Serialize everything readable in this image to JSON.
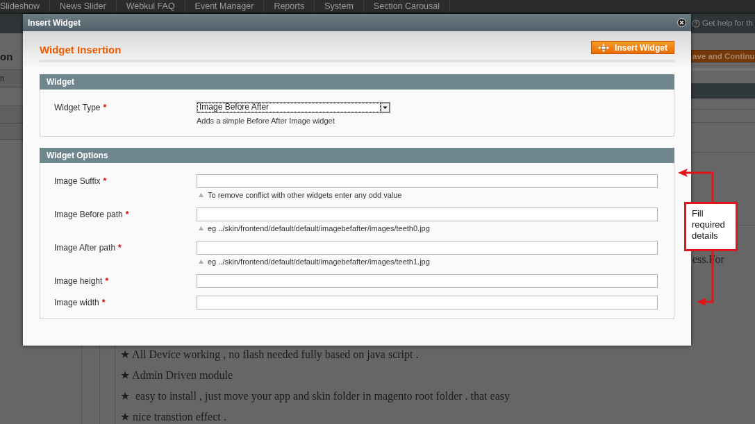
{
  "admin_nav": {
    "items": [
      "Slideshow",
      "News Slider",
      "Webkul FAQ",
      "Event Manager",
      "Reports",
      "System",
      "Section Carousal"
    ]
  },
  "header": {
    "help_text": "Get help for th"
  },
  "sidebar": {
    "heading": "on",
    "items": [
      "n"
    ]
  },
  "page": {
    "save_button": "ave and Continu",
    "paragraph_fragment": "ess.For",
    "features": [
      "★ All Device working , no flash needed fully based on java script .",
      "★ Admin Driven module",
      "★  easy to install , just move your app and skin folder in magento root folder . that easy",
      "★ nice transtion effect ."
    ]
  },
  "dialog": {
    "title": "Insert Widget",
    "heading": "Widget Insertion",
    "insert_button": "Insert Widget",
    "fieldsets": [
      {
        "title": "Widget",
        "fields": [
          {
            "kind": "select",
            "label": "Widget Type",
            "required_mark": "*",
            "value": "Image Before After",
            "focused": true,
            "note": "Adds a simple Before After Image widget"
          }
        ]
      },
      {
        "title": "Widget Options",
        "fields": [
          {
            "kind": "text",
            "label": "Image Suffix",
            "required_mark": "*",
            "note": "To remove conflict with other widgets enter any odd value"
          },
          {
            "kind": "text",
            "label": "Image Before path",
            "required_mark": "*",
            "note": "eg ../skin/frontend/default/default/imagebefafter/images/teeth0.jpg"
          },
          {
            "kind": "text",
            "label": "Image After path",
            "required_mark": "*",
            "note": "eg ../skin/frontend/default/default/imagebefafter/images/teeth1.jpg"
          },
          {
            "kind": "text",
            "label": "Image height",
            "required_mark": "*"
          },
          {
            "kind": "text",
            "label": "Image width",
            "required_mark": "*"
          }
        ]
      }
    ]
  },
  "annotation": {
    "text": "Fill required details"
  }
}
